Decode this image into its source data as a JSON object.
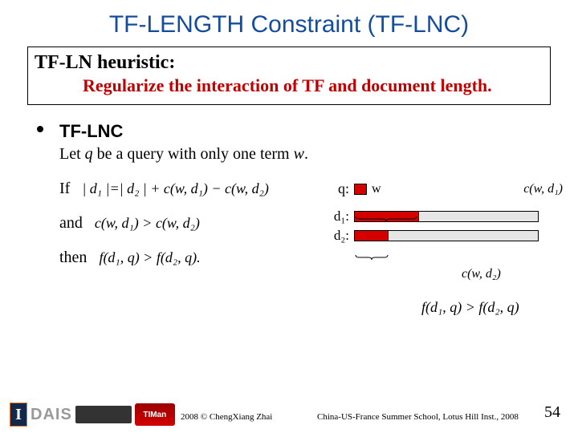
{
  "title": "TF-LENGTH Constraint (TF-LNC)",
  "box": {
    "line1": "TF-LN heuristic:",
    "line2": "Regularize the interaction of TF and document length."
  },
  "section_label": "TF-LNC",
  "let_prefix": "Let ",
  "let_q": "q",
  "let_mid": " be a query with only one term ",
  "let_w": "w",
  "let_suffix": ".",
  "if_label": "If",
  "if_formula": "| d₁ |=| d₂ | + c(w, d₁) − c(w, d₂)",
  "and_label": "and",
  "and_formula": "c(w, d₁) > c(w, d₂)",
  "then_label": "then",
  "then_formula": "f(d₁, q) > f(d₂, q).",
  "diagram": {
    "q_label": "q:",
    "w_label": "w",
    "cw1": "c(w, d₁)",
    "d1_label": "d₁:",
    "d2_label": "d₂:",
    "cw2": "c(w, d₂)",
    "finaleq": "f(d₁, q) > f(d₂, q)"
  },
  "footer": {
    "logo_i": "I",
    "dais": "DAIS",
    "timan": "TIMan",
    "copyright": "2008 © ChengXiang Zhai",
    "venue": "China-US-France Summer School, Lotus Hill Inst., 2008",
    "page": "54"
  }
}
